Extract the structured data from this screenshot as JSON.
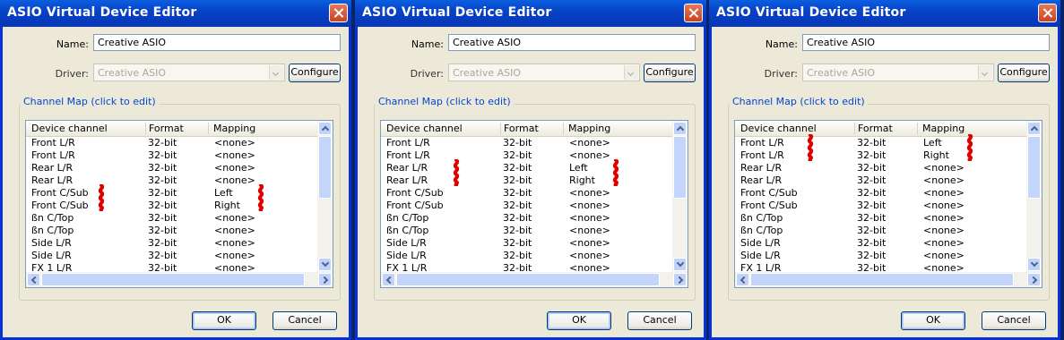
{
  "dialog": {
    "title": "ASIO Virtual Device Editor",
    "name_label": "Name:",
    "name_value": "Creative ASIO",
    "driver_label": "Driver:",
    "driver_value": "Creative ASIO",
    "configure_label": "Configure",
    "group_title": "Channel Map (click to edit)",
    "columns": [
      "Device channel",
      "Format",
      "Mapping"
    ],
    "ok_label": "OK",
    "cancel_label": "Cancel"
  },
  "panels": [
    {
      "rows": [
        [
          "Front L/R",
          "32-bit",
          "<none>"
        ],
        [
          "Front L/R",
          "32-bit",
          "<none>"
        ],
        [
          "Rear L/R",
          "32-bit",
          "<none>"
        ],
        [
          "Rear L/R",
          "32-bit",
          "<none>"
        ],
        [
          "Front C/Sub",
          "32-bit",
          "Left"
        ],
        [
          "Front C/Sub",
          "32-bit",
          "Right"
        ],
        [
          "ßn C/Top",
          "32-bit",
          "<none>"
        ],
        [
          "ßn C/Top",
          "32-bit",
          "<none>"
        ],
        [
          "Side L/R",
          "32-bit",
          "<none>"
        ],
        [
          "Side L/R",
          "32-bit",
          "<none>"
        ],
        [
          "FX 1 L/R",
          "32-bit",
          "<none>"
        ]
      ],
      "marked_rows": [
        4,
        5
      ]
    },
    {
      "rows": [
        [
          "Front L/R",
          "32-bit",
          "<none>"
        ],
        [
          "Front L/R",
          "32-bit",
          "<none>"
        ],
        [
          "Rear L/R",
          "32-bit",
          "Left"
        ],
        [
          "Rear L/R",
          "32-bit",
          "Right"
        ],
        [
          "Front C/Sub",
          "32-bit",
          "<none>"
        ],
        [
          "Front C/Sub",
          "32-bit",
          "<none>"
        ],
        [
          "ßn C/Top",
          "32-bit",
          "<none>"
        ],
        [
          "ßn C/Top",
          "32-bit",
          "<none>"
        ],
        [
          "Side L/R",
          "32-bit",
          "<none>"
        ],
        [
          "Side L/R",
          "32-bit",
          "<none>"
        ],
        [
          "FX 1 L/R",
          "32-bit",
          "<none>"
        ]
      ],
      "marked_rows": [
        2,
        3
      ]
    },
    {
      "rows": [
        [
          "Front L/R",
          "32-bit",
          "Left"
        ],
        [
          "Front L/R",
          "32-bit",
          "Right"
        ],
        [
          "Rear L/R",
          "32-bit",
          "<none>"
        ],
        [
          "Rear L/R",
          "32-bit",
          "<none>"
        ],
        [
          "Front C/Sub",
          "32-bit",
          "<none>"
        ],
        [
          "Front C/Sub",
          "32-bit",
          "<none>"
        ],
        [
          "ßn C/Top",
          "32-bit",
          "<none>"
        ],
        [
          "ßn C/Top",
          "32-bit",
          "<none>"
        ],
        [
          "Side L/R",
          "32-bit",
          "<none>"
        ],
        [
          "Side L/R",
          "32-bit",
          "<none>"
        ],
        [
          "FX 1 L/R",
          "32-bit",
          "<none>"
        ]
      ],
      "marked_rows": [
        0,
        1
      ]
    }
  ],
  "colors": {
    "title_bar": "#0842c8",
    "close_button": "#d0552f",
    "group_title": "#0046d5",
    "annotation": "#e00000"
  },
  "icons": {
    "close": "close-icon",
    "dropdown": "chevron-down-icon",
    "scroll_up": "chevron-up-icon",
    "scroll_down": "chevron-down-icon",
    "scroll_left": "chevron-left-icon",
    "scroll_right": "chevron-right-icon"
  }
}
